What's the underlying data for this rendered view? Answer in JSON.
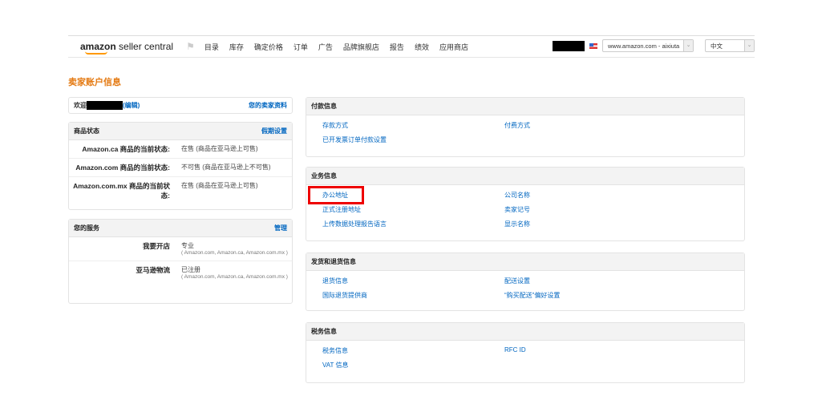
{
  "nav": {
    "logo_bold": "amazon",
    "logo_rest": " seller central",
    "menu": [
      "目录",
      "库存",
      "确定价格",
      "订单",
      "广告",
      "品牌旗舰店",
      "报告",
      "绩效",
      "应用商店"
    ],
    "marketplace": "www.amazon.com - aixiuta",
    "language": "中文"
  },
  "page_title": "卖家账户信息",
  "welcome": {
    "label": "欢迎",
    "edit": "(编辑)",
    "profile_link": "您的卖家资料"
  },
  "listing_status": {
    "title": "商品状态",
    "action": "假期设置",
    "rows": [
      {
        "k": "Amazon.ca 商品的当前状态:",
        "v": "在售 (商品在亚马逊上可售)"
      },
      {
        "k": "Amazon.com 商品的当前状态:",
        "v": "不可售 (商品在亚马逊上不可售)"
      },
      {
        "k": "Amazon.com.mx 商品的当前状态:",
        "v": "在售 (商品在亚马逊上可售)"
      }
    ]
  },
  "services": {
    "title": "您的服务",
    "action": "管理",
    "rows": [
      {
        "k": "我要开店",
        "v": "专业",
        "sub": "( Amazon.com, Amazon.ca, Amazon.com.mx )"
      },
      {
        "k": "亚马逊物流",
        "v": "已注册",
        "sub": "( Amazon.com, Amazon.ca, Amazon.com.mx )"
      }
    ]
  },
  "sections": [
    {
      "title": "付款信息",
      "links": [
        "存款方式",
        "付费方式",
        "已开发票订单付款设置"
      ]
    },
    {
      "title": "业务信息",
      "links": [
        "办公地址",
        "公司名称",
        "正式注册地址",
        "卖家记号",
        "上传数据处理报告语言",
        "显示名称"
      ]
    },
    {
      "title": "发货和退货信息",
      "links": [
        "退货信息",
        "配送设置",
        "国际退货提供商",
        "“购买配送”偏好设置"
      ]
    },
    {
      "title": "税务信息",
      "links": [
        "税务信息",
        "RFC ID",
        "VAT 信息"
      ]
    }
  ]
}
